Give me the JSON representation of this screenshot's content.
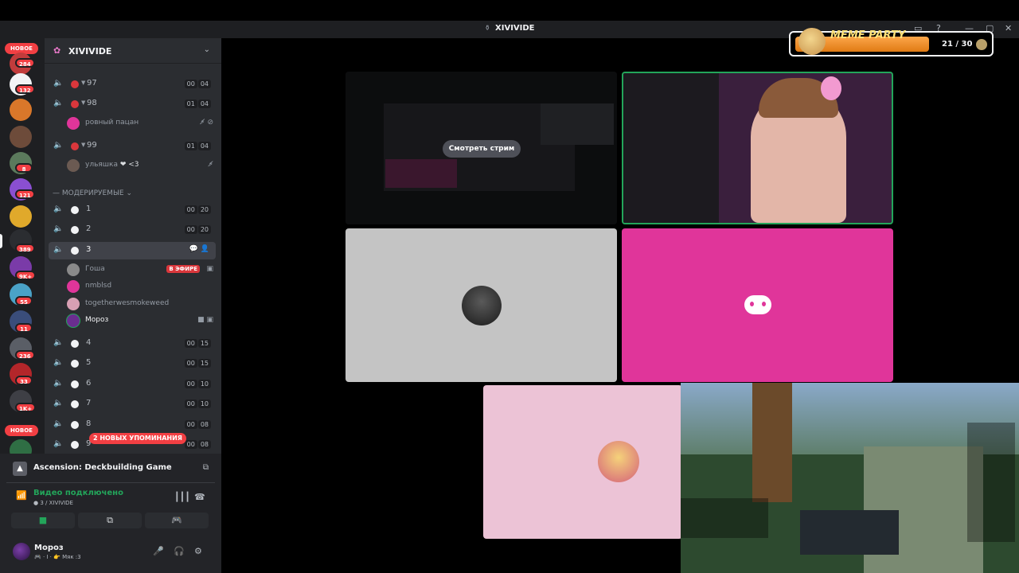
{
  "window": {
    "title": "XIVIVIDE",
    "min_icon": "minimize-icon",
    "max_icon": "maximize-icon",
    "close_icon": "close-icon",
    "help_icon": "help-icon"
  },
  "guilds": {
    "new_top": "НОВОЕ",
    "new_bottom": "НОВОЕ",
    "badges": [
      "284",
      "132",
      "8",
      "121",
      "389",
      "9K+",
      "55",
      "11",
      "236",
      "33",
      "1K+"
    ]
  },
  "server": {
    "name": "XIVIVIDE",
    "category": "— МОДЕРИРУЕМЫЕ ⌄"
  },
  "channels_top": [
    {
      "name": "97",
      "c1": "00",
      "c2": "04"
    },
    {
      "name": "98",
      "c1": "01",
      "c2": "04"
    },
    {
      "name": "99",
      "c1": "01",
      "c2": "04"
    }
  ],
  "members_top": [
    {
      "name": "ровный пацан"
    },
    {
      "name": "ульяшка",
      "extra": "❤ <3"
    }
  ],
  "channels_mod": [
    {
      "name": "1",
      "c1": "00",
      "c2": "20"
    },
    {
      "name": "2",
      "c1": "00",
      "c2": "20"
    },
    {
      "name": "3"
    },
    {
      "name": "4",
      "c1": "00",
      "c2": "15"
    },
    {
      "name": "5",
      "c1": "00",
      "c2": "15"
    },
    {
      "name": "6",
      "c1": "00",
      "c2": "10"
    },
    {
      "name": "7",
      "c1": "00",
      "c2": "10"
    },
    {
      "name": "8",
      "c1": "00",
      "c2": "08"
    },
    {
      "name": "9",
      "c1": "00",
      "c2": "08"
    }
  ],
  "members_3": [
    {
      "name": "Гоша",
      "badge": "В ЭФИРЕ"
    },
    {
      "name": "nmblsd"
    },
    {
      "name": "togetherwesmokeweed"
    },
    {
      "name": "Мороз"
    }
  ],
  "mentions": "2 НОВЫХ УПОМИНАНИЯ",
  "panel": {
    "game": "Ascension: Deckbuilding Game",
    "voice_title": "Видео подключено",
    "voice_sub": "3 / XIVIVIDE"
  },
  "user": {
    "name": "Мороз",
    "status": "🎮 · I · 👉 Мяк :3"
  },
  "stage": {
    "watch_label": "Смотреть стрим"
  },
  "overlay": {
    "title": "MEME PARTY",
    "score": "21 / 30",
    "progress": 0.7
  },
  "colors": {
    "accent_green": "#23a55a",
    "notif_red": "#f23f43",
    "discord_pink": "#e0359a"
  }
}
